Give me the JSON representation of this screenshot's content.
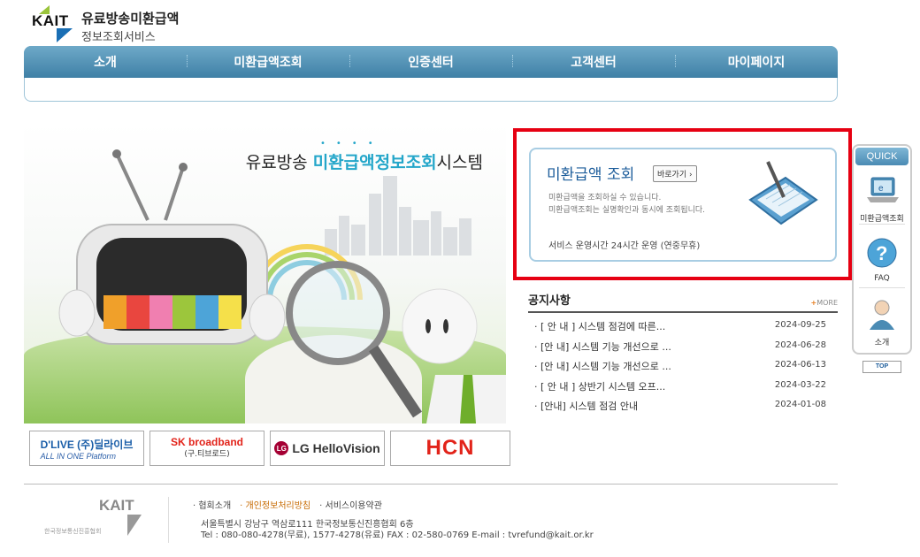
{
  "logo": {
    "mark": "KAIT",
    "line1": "유료방송미환급액",
    "line2": "정보조회서비스"
  },
  "nav": {
    "items": [
      "소개",
      "미환급액조회",
      "인증센터",
      "고객센터",
      "마이페이지"
    ]
  },
  "hero": {
    "title_prefix": "유료방송 ",
    "title_highlight": "미환급액정보조회",
    "title_suffix": "시스템"
  },
  "partners": {
    "dlive": {
      "name": "D'LIVE (주)딜라이브",
      "sub": "ALL IN ONE Platform"
    },
    "sk": {
      "name": "SK broadband",
      "sub": "(구.티브로드)"
    },
    "lg": {
      "name": "LG HelloVision"
    },
    "hcn": {
      "name": "HCN"
    }
  },
  "search_card": {
    "title": "미환급액 조회",
    "button": "바로가기 ›",
    "desc1": "미환급액을 조회하실 수 있습니다.",
    "desc2": "미환급액조회는 실명확인과 동시에 조회됩니다.",
    "hours": "서비스 운영시간  24시간 운영 (연중무휴)"
  },
  "notice": {
    "title": "공지사항",
    "more": "MORE",
    "items": [
      {
        "title": "· [ 안 내 ] 시스템 점검에 따른...",
        "date": "2024-09-25"
      },
      {
        "title": "· [안 내] 시스템 기능 개선으로 ...",
        "date": "2024-06-28"
      },
      {
        "title": "· [안 내] 시스템 기능 개선으로 ...",
        "date": "2024-06-13"
      },
      {
        "title": "· [ 안 내 ] 상반기 시스템 오프...",
        "date": "2024-03-22"
      },
      {
        "title": "· [안내] 시스템 점검 안내",
        "date": "2024-01-08"
      }
    ]
  },
  "quick": {
    "head": "QUICK",
    "items": [
      {
        "label": "미환급액조회",
        "icon": "laptop-icon"
      },
      {
        "label": "FAQ",
        "icon": "question-icon"
      },
      {
        "label": "소개",
        "icon": "person-icon"
      }
    ],
    "top": "TOP"
  },
  "footer": {
    "logo_mark": "KAIT",
    "org": "한국정보통신진흥협회",
    "links": [
      "· 협회소개",
      "· 개인정보처리방침",
      "· 서비스이용약관"
    ],
    "address": "서울특별시 강남구 역삼로111 한국정보통신진흥협회 6층",
    "contact": "Tel : 080-080-4278(무료), 1577-4278(유료)   FAX : 02-580-0769   E-mail : tvrefund@kait.or.kr"
  },
  "colors": {
    "accent": "#23a6c9",
    "nav": "#4a8bb4",
    "highlight": "#e60012",
    "title_blue": "#1d5d9b"
  }
}
